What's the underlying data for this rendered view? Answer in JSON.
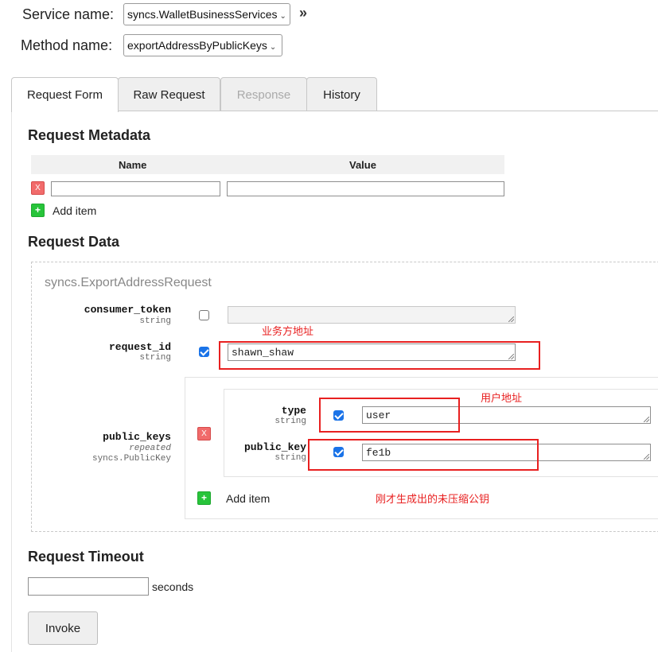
{
  "service": {
    "label": "Service name:",
    "value": "syncs.WalletBusinessServices"
  },
  "method": {
    "label": "Method name:",
    "value": "exportAddressByPublicKeys"
  },
  "tabs": [
    "Request Form",
    "Raw Request",
    "Response",
    "History"
  ],
  "metadata": {
    "title": "Request Metadata",
    "col_name": "Name",
    "col_value": "Value",
    "remove_label": "X",
    "add_label": "Add item"
  },
  "request_data": {
    "title": "Request Data",
    "message_type": "syncs.ExportAddressRequest",
    "fields": {
      "consumer_token": {
        "name": "consumer_token",
        "type": "string",
        "checked": false,
        "value": ""
      },
      "request_id": {
        "name": "request_id",
        "type": "string",
        "checked": true,
        "value": "shawn_shaw"
      },
      "public_keys": {
        "name": "public_keys",
        "modifier": "repeated",
        "type": "syncs.PublicKey",
        "remove_label": "X",
        "add_label": "Add item",
        "item": {
          "type": {
            "name": "type",
            "type": "string",
            "checked": true,
            "value": "user"
          },
          "public_key": {
            "name": "public_key",
            "type": "string",
            "checked": true,
            "value": "fe1b"
          }
        }
      }
    }
  },
  "annotations": {
    "business_address": "业务方地址",
    "user_address": "用户地址",
    "uncompressed_key": "刚才生成出的未压缩公钥",
    "color": "#e82020"
  },
  "timeout": {
    "title": "Request Timeout",
    "value": "",
    "unit": "seconds"
  },
  "invoke": {
    "label": "Invoke"
  },
  "colors": {
    "add": "#27c43a",
    "remove": "#f16b6b",
    "checkbox": "#1a73e8"
  }
}
